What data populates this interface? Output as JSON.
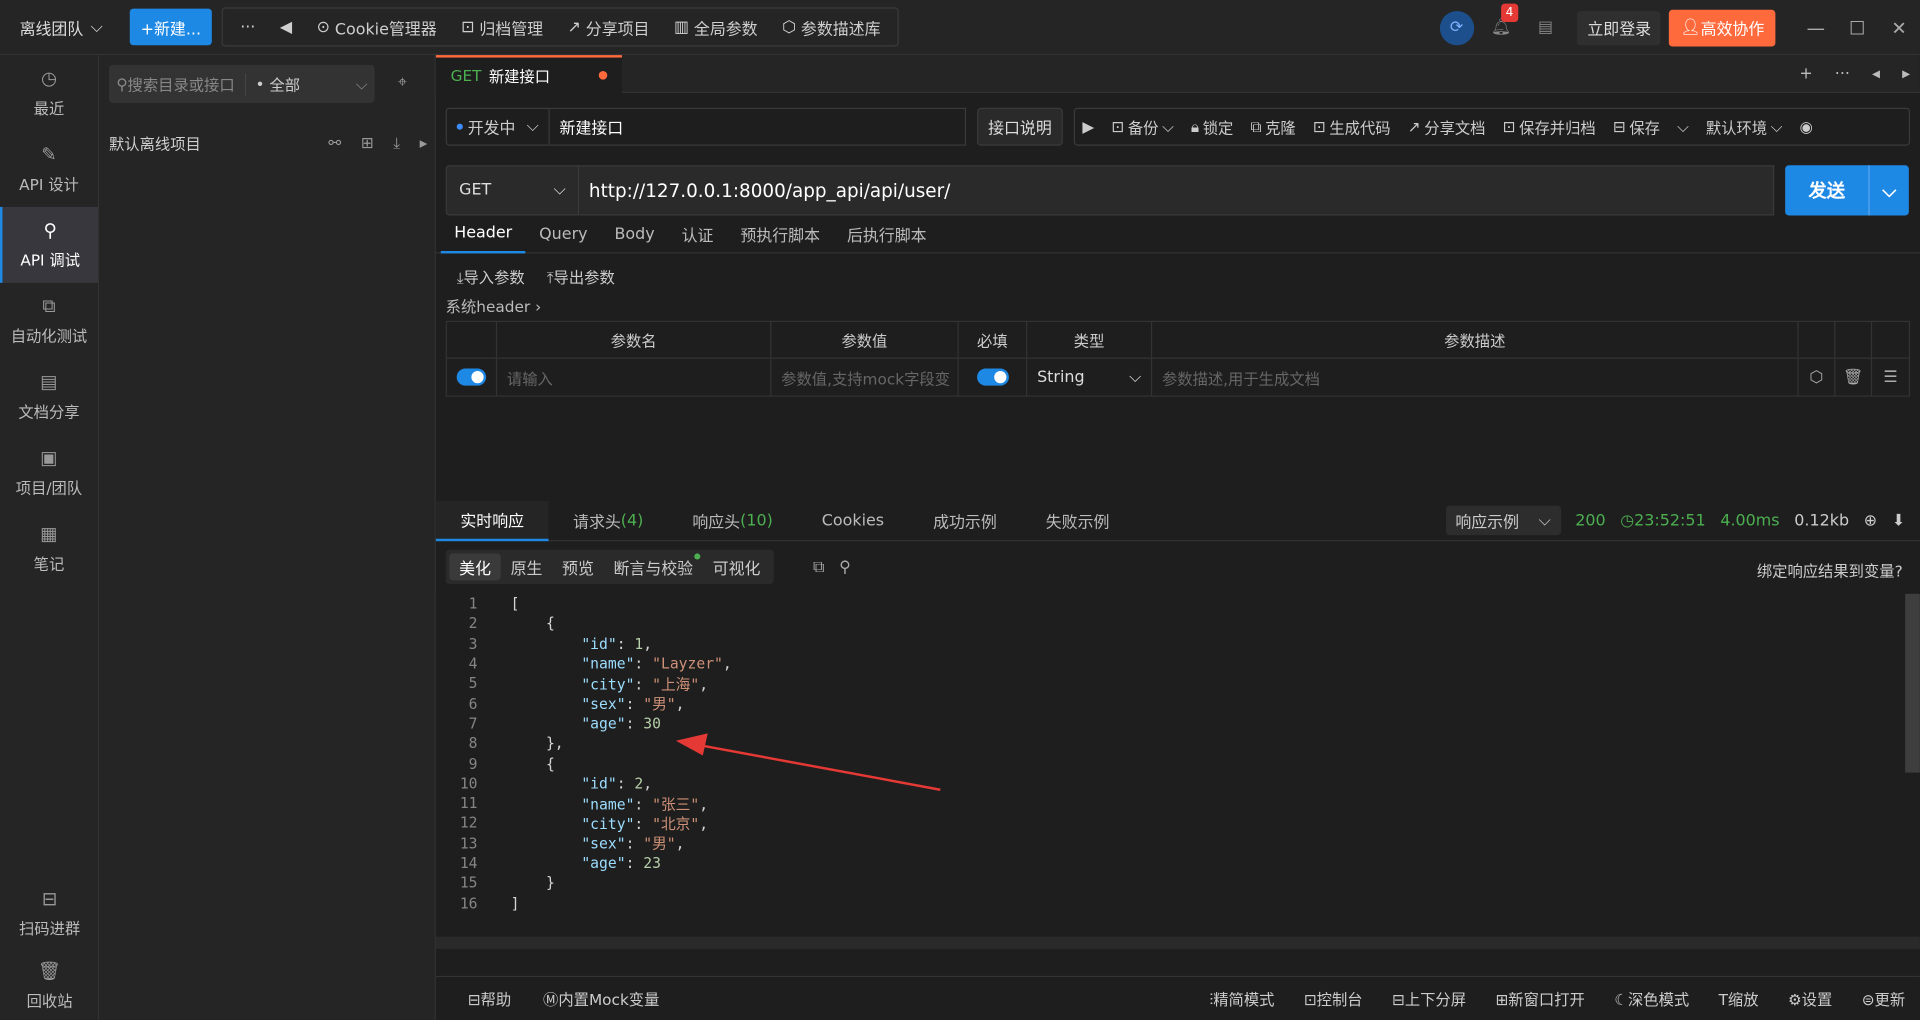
{
  "topbar": {
    "team": "离线团队",
    "new_label": "+新建...",
    "more": "···",
    "items": [
      {
        "label": "Cookie管理器"
      },
      {
        "label": "归档管理"
      },
      {
        "label": "分享项目"
      },
      {
        "label": "全局参数"
      },
      {
        "label": "参数描述库"
      }
    ],
    "notif_count": "4",
    "login": "立即登录",
    "collab": "高效协作"
  },
  "leftnav": {
    "items": [
      {
        "label": "最近"
      },
      {
        "label": "API 设计"
      },
      {
        "label": "API 调试"
      },
      {
        "label": "自动化测试"
      },
      {
        "label": "文档分享"
      },
      {
        "label": "项目/团队"
      },
      {
        "label": "笔记"
      }
    ],
    "bottom": [
      {
        "label": "扫码进群"
      },
      {
        "label": "回收站"
      }
    ]
  },
  "sidebar": {
    "search_placeholder": "搜索目录或接口",
    "filter": "全部",
    "project": "默认离线项目"
  },
  "tab": {
    "method": "GET",
    "name": "新建接口"
  },
  "request": {
    "status": "开发中",
    "name": "新建接口",
    "desc_btn": "接口说明",
    "actions": [
      "备份",
      "锁定",
      "克隆",
      "生成代码",
      "分享文档",
      "保存并归档",
      "保存"
    ],
    "env": "默认环境",
    "method": "GET",
    "url": "http://127.0.0.1:8000/app_api/api/user/",
    "send": "发送"
  },
  "subtabs": [
    "Header",
    "Query",
    "Body",
    "认证",
    "预执行脚本",
    "后执行脚本"
  ],
  "params": {
    "import": "导入参数",
    "export": "导出参数",
    "sys_header": "系统header",
    "headers": [
      "参数名",
      "参数值",
      "必填",
      "类型",
      "参数描述"
    ],
    "name_ph": "请输入",
    "value_ph": "参数值,支持mock字段变",
    "type": "String",
    "desc_ph": "参数描述,用于生成文档"
  },
  "response": {
    "tabs": [
      {
        "label": "实时响应",
        "count": ""
      },
      {
        "label": "请求头",
        "count": "(4)"
      },
      {
        "label": "响应头",
        "count": "(10)"
      },
      {
        "label": "Cookies",
        "count": ""
      },
      {
        "label": "成功示例",
        "count": ""
      },
      {
        "label": "失败示例",
        "count": ""
      }
    ],
    "example_sel": "响应示例",
    "code": "200",
    "time": "23:52:51",
    "duration": "4.00ms",
    "size": "0.12kb",
    "views": [
      "美化",
      "原生",
      "预览",
      "断言与校验",
      "可视化"
    ],
    "bind": "绑定响应结果到变量?"
  },
  "footer": {
    "left": [
      "帮助",
      "内置Mock变量"
    ],
    "right": [
      "精简模式",
      "控制台",
      "上下分屏",
      "新窗口打开",
      "深色模式",
      "缩放",
      "设置",
      "更新"
    ]
  },
  "colors": {
    "accent": "#1e88e5",
    "orange": "#ff6a3d",
    "green": "#4caf50"
  }
}
